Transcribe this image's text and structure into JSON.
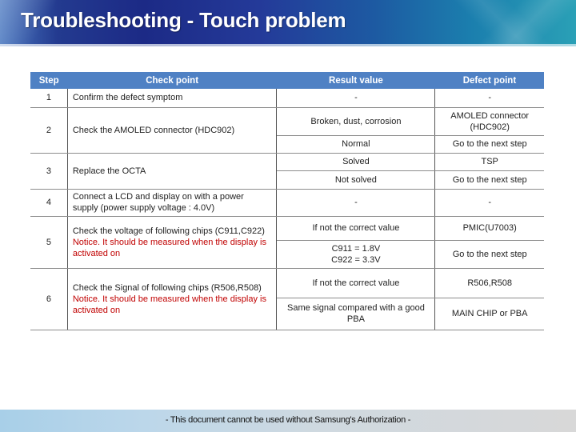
{
  "header": {
    "title": "Troubleshooting - Touch problem"
  },
  "table": {
    "columns": [
      "Step",
      "Check point",
      "Result value",
      "Defect point"
    ],
    "rows": [
      {
        "step": "1",
        "check": "Confirm the defect symptom",
        "notice": "",
        "results": [
          {
            "result": "-",
            "defect": "-"
          }
        ]
      },
      {
        "step": "2",
        "check": "Check the AMOLED connector (HDC902)",
        "notice": "",
        "results": [
          {
            "result": "Broken, dust, corrosion",
            "defect": "AMOLED connector (HDC902)"
          },
          {
            "result": "Normal",
            "defect": "Go to the next step"
          }
        ]
      },
      {
        "step": "3",
        "check": "Replace the OCTA",
        "notice": "",
        "results": [
          {
            "result": "Solved",
            "defect": "TSP"
          },
          {
            "result": "Not solved",
            "defect": "Go to the next step"
          }
        ]
      },
      {
        "step": "4",
        "check": "Connect a LCD and display on with a power supply (power supply voltage : 4.0V)",
        "notice": "",
        "results": [
          {
            "result": "-",
            "defect": "-"
          }
        ]
      },
      {
        "step": "5",
        "check": "Check the voltage of following chips (C911,C922)",
        "notice": "Notice. It should be measured when the display is activated on",
        "results": [
          {
            "result": "If not the correct value",
            "defect": "PMIC(U7003)"
          },
          {
            "result": "C911 = 1.8V",
            "result_line2": "C922 = 3.3V",
            "defect": "Go to the next step"
          }
        ]
      },
      {
        "step": "6",
        "check": "Check the Signal of following chips (R506,R508)",
        "notice": "Notice. It should be measured when the display is activated on",
        "results": [
          {
            "result": "If not the correct value",
            "defect": "R506,R508"
          },
          {
            "result": "Same signal compared with a good PBA",
            "defect": "MAIN CHIP or PBA"
          }
        ]
      }
    ]
  },
  "footer": {
    "text": "- This document cannot be used without Samsung's Authorization -"
  },
  "colors": {
    "table_header": "#4f81c4",
    "notice_text": "#c00000",
    "title_text": "#ffffff"
  }
}
